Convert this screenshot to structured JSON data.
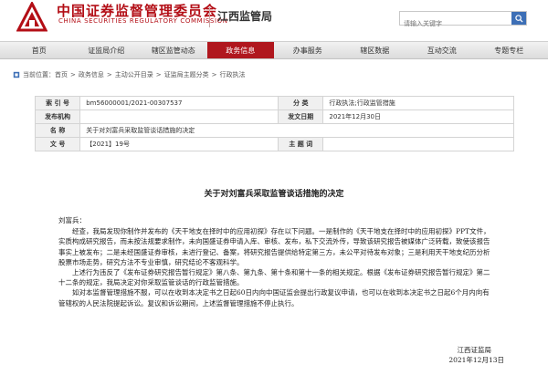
{
  "header": {
    "org_name_cn": "中国证券监督管理委员会",
    "org_name_en": "CHINA SECURITIES REGULATORY COMMISSION",
    "bureau": "江西监管局",
    "search": {
      "placeholder": "请输入关键字"
    }
  },
  "nav": {
    "items": [
      {
        "label": "首页"
      },
      {
        "label": "证监局介绍"
      },
      {
        "label": "辖区监管动态"
      },
      {
        "label": "政务信息",
        "active": true
      },
      {
        "label": "办事服务"
      },
      {
        "label": "辖区数据"
      },
      {
        "label": "互动交流"
      },
      {
        "label": "专题专栏"
      }
    ],
    "active_color": "#b0171e"
  },
  "breadcrumb": {
    "prefix": "当前位置：",
    "items": [
      "首页",
      "政务信息",
      "主动公开目录",
      "证监局主题分类",
      "行政执法"
    ]
  },
  "info": {
    "index_label": "索 引 号",
    "index_value": "bm56000001/2021-00307537",
    "category_label": "分 类",
    "category_value": "行政执法;行政监管措施",
    "issuer_label": "发布机构",
    "issuer_value": "",
    "date_label": "发文日期",
    "date_value": "2021年12月30日",
    "name_label": "名 称",
    "name_value": "关于对刘富兵采取监管谈话措施的决定",
    "docno_label": "文 号",
    "docno_value": "【2021】19号",
    "keyword_label": "主 题 词",
    "keyword_value": ""
  },
  "document": {
    "title": "关于对刘富兵采取监管谈话措施的决定",
    "salutation": "刘富兵：",
    "paragraphs": [
      "经查，我局发现你制作并发布的《天干地支在择时中的应用初探》存在以下问题。一是制作的《天干地支在择时中的应用初探》PPT文件，实质构成研究报告，而未按法规要求制作，未向国盛证券申请入库、审核、发布，私下交流外传，导致该研究报告被媒体广泛转载，致使该报告事实上被发布；二是未经国盛证券审核，未进行登记、备案，将研究报告提供给特定第三方，未公平对待发布对象；三是利用天干地支纪历分析股票市场走势，研究方法不专业审慎，研究结论不客观科学。",
      "上述行为违反了《发布证券研究报告暂行规定》第八条、第九条、第十条和第十一条的相关规定。根据《发布证券研究报告暂行规定》第二十二条的规定，我局决定对你采取监管谈话的行政监管措施。",
      "如对本监督管理措施不服，可以在收到本决定书之日起60日内向中国证监会提出行政复议申请，也可以在收到本决定书之日起6个月内向有管辖权的人民法院提起诉讼。复议和诉讼期间，上述监督管理措施不停止执行。"
    ],
    "sign_org": "江西证监局",
    "sign_date": "2021年12月13日"
  }
}
